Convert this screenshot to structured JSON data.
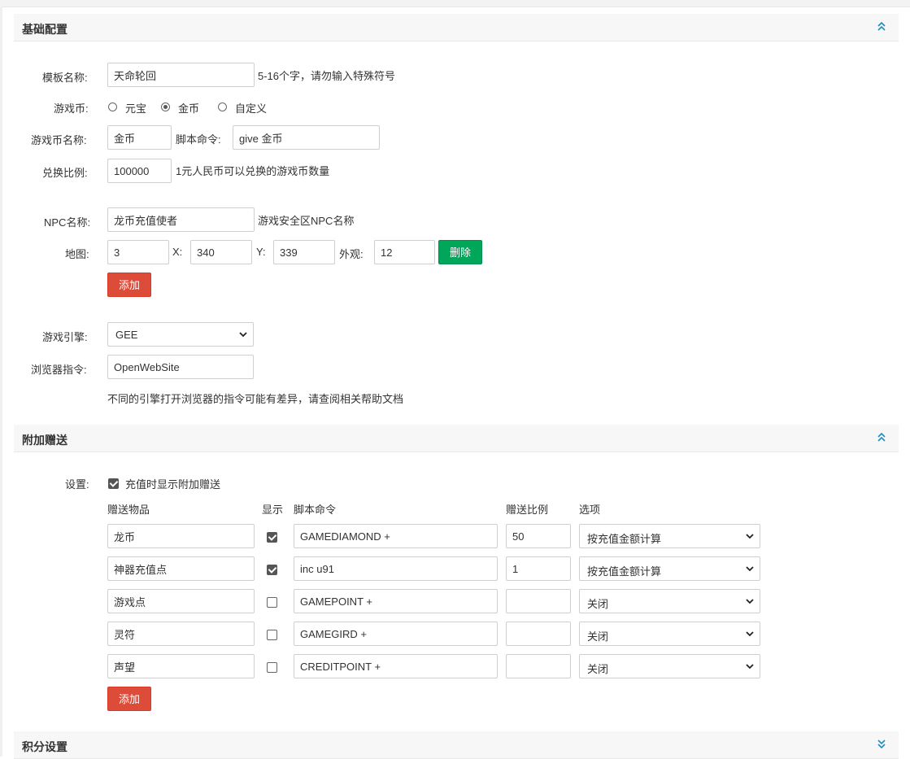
{
  "sections": {
    "basic": {
      "title": "基础配置",
      "chevron": "chevron-up-double-icon"
    },
    "bonus": {
      "title": "附加赠送",
      "chevron": "chevron-up-double-icon"
    },
    "points": {
      "title": "积分设置",
      "chevron": "chevron-down-double-icon"
    }
  },
  "basic": {
    "template_name": {
      "label": "模板名称:",
      "value": "天命轮回",
      "hint": "5-16个字，请勿输入特殊符号"
    },
    "currency": {
      "label": "游戏币:",
      "options": [
        {
          "label": "元宝",
          "selected": false
        },
        {
          "label": "金币",
          "selected": true
        },
        {
          "label": "自定义",
          "selected": false
        }
      ]
    },
    "currency_name": {
      "label": "游戏币名称:",
      "value": "金币",
      "script_label": "脚本命令:",
      "script_value": "give 金币"
    },
    "exchange_ratio": {
      "label": "兑换比例:",
      "value": "100000",
      "hint": "1元人民币可以兑换的游戏币数量"
    },
    "npc_name": {
      "label": "NPC名称:",
      "value": "龙币充值使者",
      "hint": "游戏安全区NPC名称"
    },
    "map": {
      "label": "地图:",
      "map_value": "3",
      "x_label": "X:",
      "x_value": "340",
      "y_label": "Y:",
      "y_value": "339",
      "look_label": "外观:",
      "look_value": "12",
      "delete_label": "删除"
    },
    "add_label": "添加",
    "engine": {
      "label": "游戏引擎:",
      "value": "GEE"
    },
    "browser_cmd": {
      "label": "浏览器指令:",
      "value": "OpenWebSite",
      "hint": "不同的引擎打开浏览器的指令可能有差异，请查阅相关帮助文档"
    }
  },
  "bonus": {
    "setting_label": "设置:",
    "show_on_recharge": {
      "label": "充值时显示附加赠送",
      "checked": true
    },
    "columns": {
      "item": "赠送物品",
      "show": "显示",
      "script": "脚本命令",
      "ratio": "赠送比例",
      "option": "选项"
    },
    "rows": [
      {
        "item": "龙币",
        "show": true,
        "script": "GAMEDIAMOND +",
        "ratio": "50",
        "option": "按充值金额计算"
      },
      {
        "item": "神器充值点",
        "show": true,
        "script": "inc u91",
        "ratio": "1",
        "option": "按充值金额计算"
      },
      {
        "item": "游戏点",
        "show": false,
        "script": "GAMEPOINT +",
        "ratio": "",
        "option": "关闭"
      },
      {
        "item": "灵符",
        "show": false,
        "script": "GAMEGIRD +",
        "ratio": "",
        "option": "关闭"
      },
      {
        "item": "声望",
        "show": false,
        "script": "CREDITPOINT +",
        "ratio": "",
        "option": "关闭"
      }
    ],
    "add_label": "添加"
  }
}
